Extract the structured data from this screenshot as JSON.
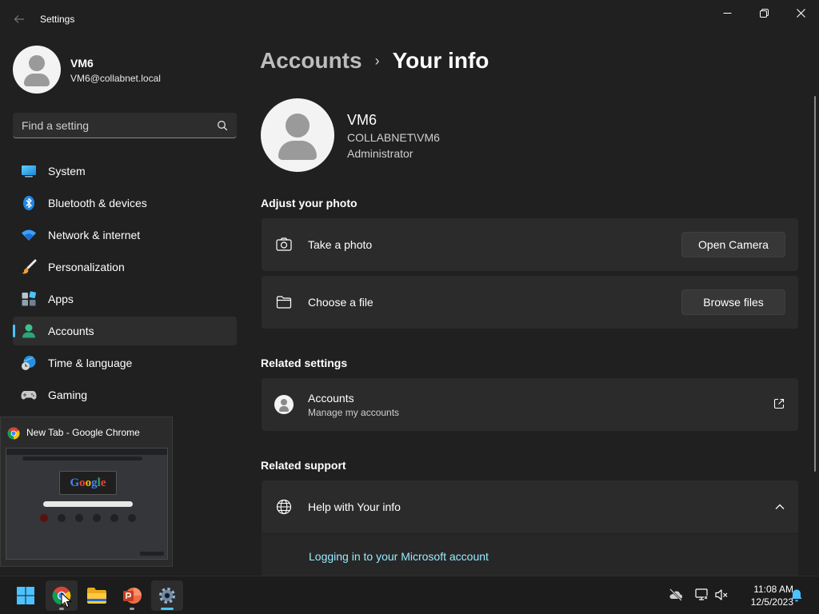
{
  "window": {
    "title": "Settings"
  },
  "profile": {
    "name": "VM6",
    "email": "VM6@collabnet.local"
  },
  "search": {
    "placeholder": "Find a setting"
  },
  "nav": {
    "items": [
      {
        "label": "System",
        "icon": "monitor-icon"
      },
      {
        "label": "Bluetooth & devices",
        "icon": "bluetooth-icon"
      },
      {
        "label": "Network & internet",
        "icon": "wifi-icon"
      },
      {
        "label": "Personalization",
        "icon": "paintbrush-icon"
      },
      {
        "label": "Apps",
        "icon": "apps-icon"
      },
      {
        "label": "Accounts",
        "icon": "person-icon",
        "active": true
      },
      {
        "label": "Time & language",
        "icon": "globe-clock-icon"
      },
      {
        "label": "Gaming",
        "icon": "gamepad-icon"
      }
    ]
  },
  "breadcrumb": {
    "parent": "Accounts",
    "separator": "›",
    "current": "Your info"
  },
  "user": {
    "name": "VM6",
    "domain": "COLLABNET\\VM6",
    "role": "Administrator"
  },
  "adjust_photo": {
    "title": "Adjust your photo",
    "take_photo": {
      "label": "Take a photo",
      "button": "Open Camera"
    },
    "choose_file": {
      "label": "Choose a file",
      "button": "Browse files"
    }
  },
  "related_settings": {
    "title": "Related settings",
    "accounts": {
      "label": "Accounts",
      "sublabel": "Manage my accounts"
    }
  },
  "related_support": {
    "title": "Related support",
    "help": {
      "label": "Help with Your info"
    },
    "links": [
      "Logging in to your Microsoft account"
    ]
  },
  "thumbnail": {
    "title": "New Tab - Google Chrome",
    "logo_text": "Google"
  },
  "taskbar": {
    "time": "11:08 AM",
    "date": "12/5/2023"
  },
  "colors": {
    "accent": "#4cc2ff",
    "background": "#202020",
    "card": "#2b2b2b",
    "link": "#99ebff"
  }
}
